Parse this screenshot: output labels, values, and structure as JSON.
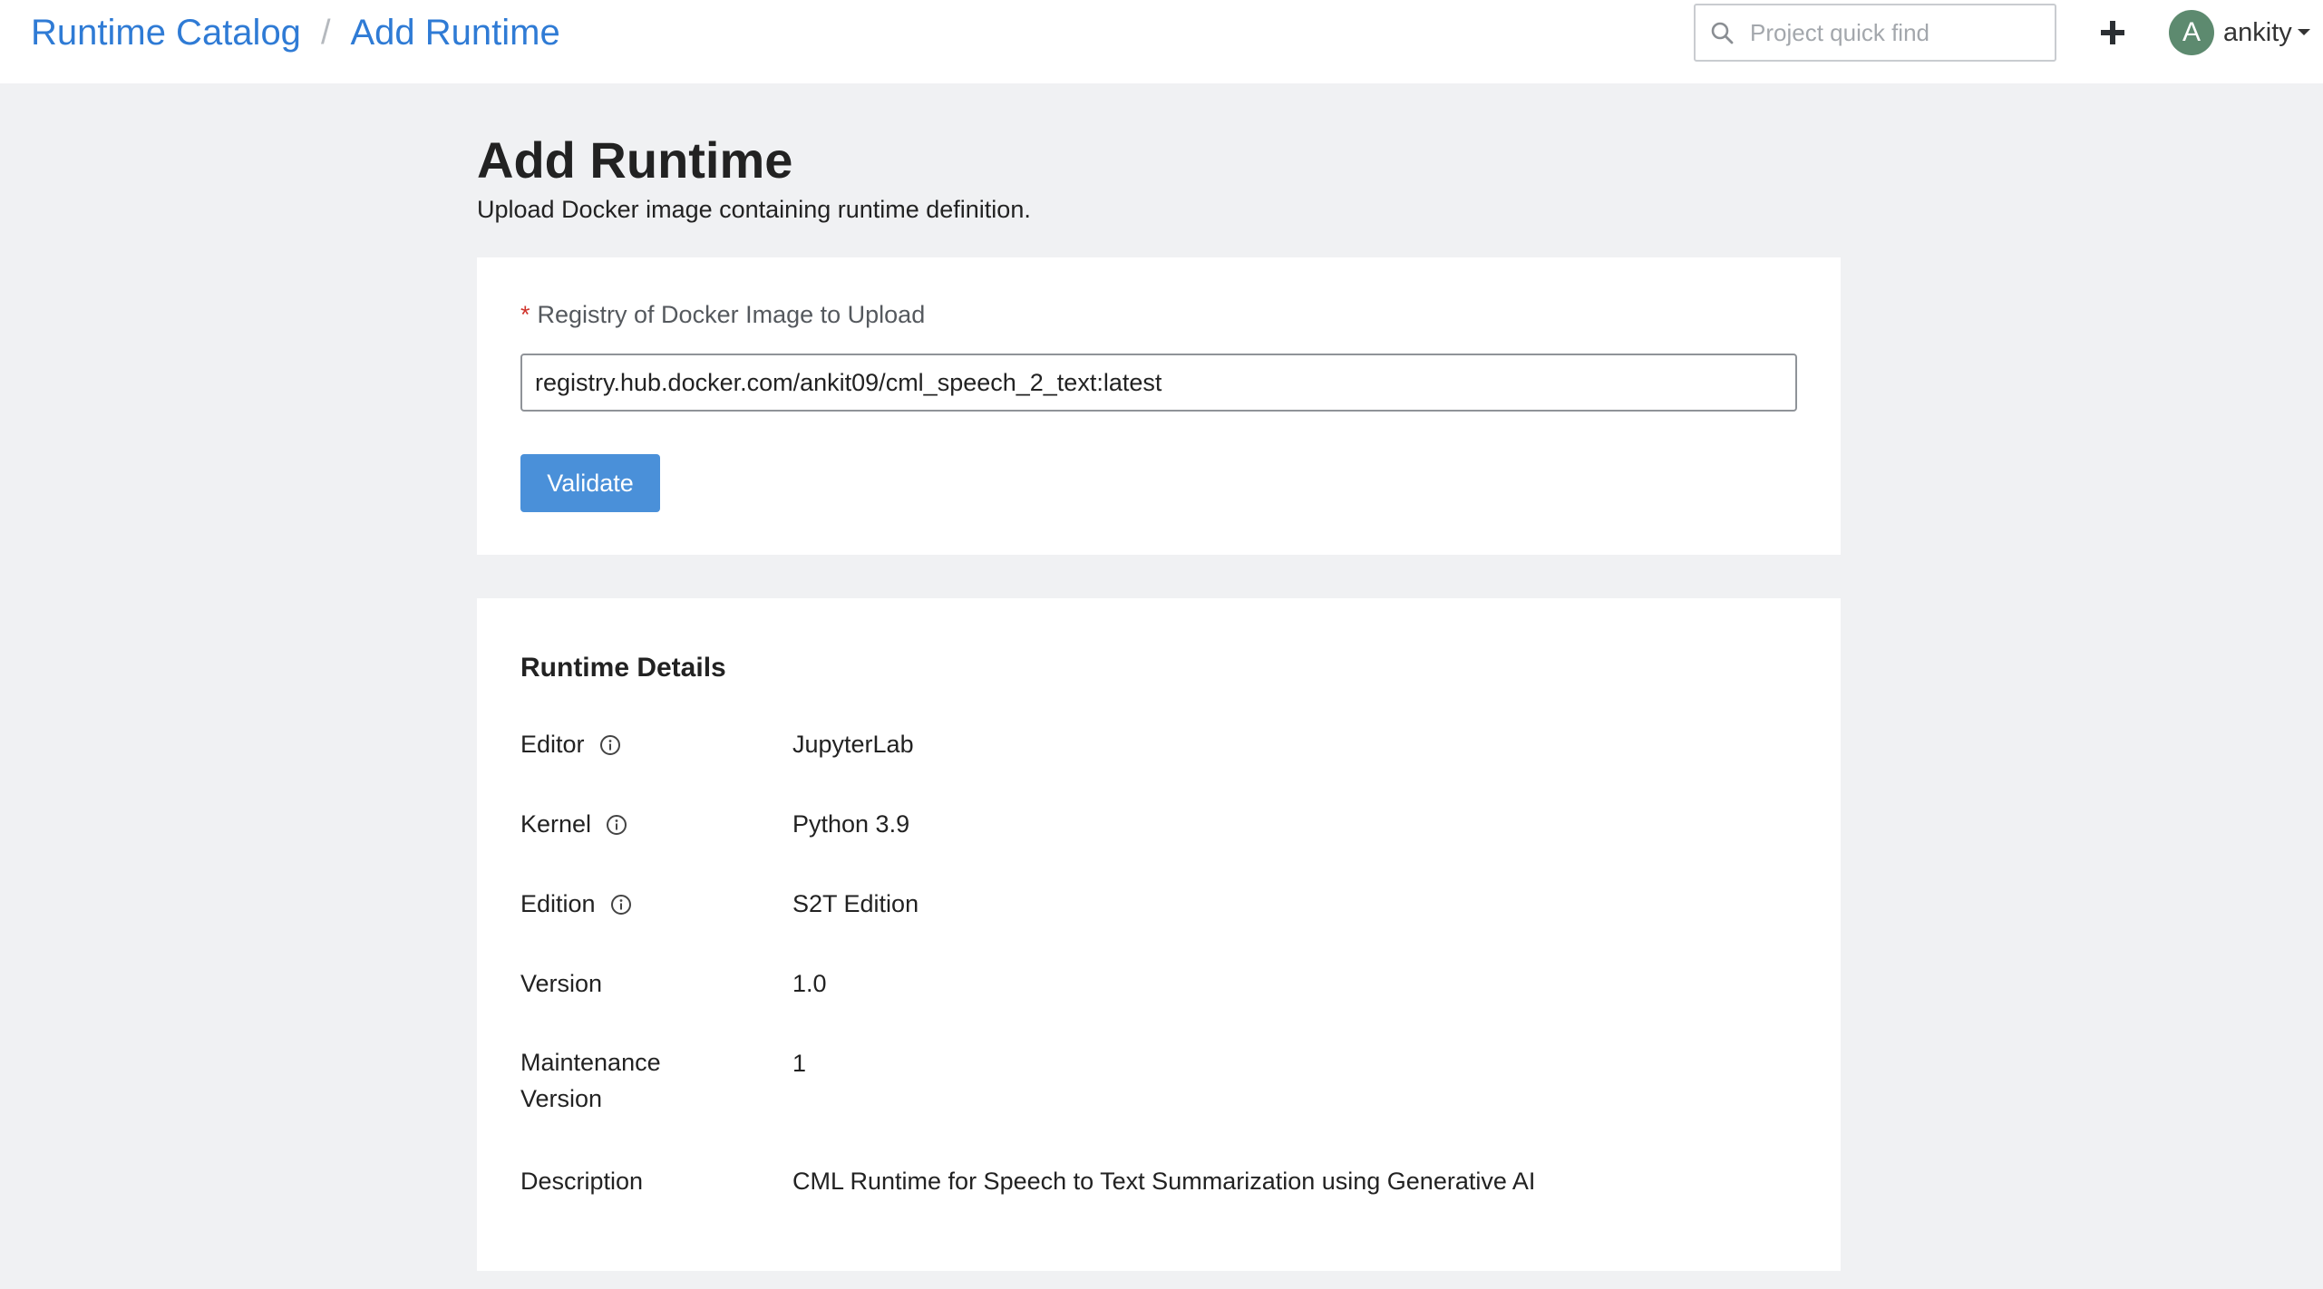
{
  "breadcrumb": {
    "parent": "Runtime Catalog",
    "separator": "/",
    "current": "Add Runtime"
  },
  "header": {
    "search_placeholder": "Project quick find",
    "user": {
      "initial": "A",
      "name": "ankity"
    },
    "avatar_color": "#5d8a6f"
  },
  "page": {
    "title": "Add Runtime",
    "subtitle": "Upload Docker image containing runtime definition."
  },
  "upload_form": {
    "required_marker": "*",
    "label": "Registry of Docker Image to Upload",
    "value": "registry.hub.docker.com/ankit09/cml_speech_2_text:latest",
    "validate_label": "Validate"
  },
  "details": {
    "title": "Runtime Details",
    "rows": [
      {
        "label": "Editor",
        "value": "JupyterLab",
        "info": true
      },
      {
        "label": "Kernel",
        "value": "Python 3.9",
        "info": true
      },
      {
        "label": "Edition",
        "value": "S2T Edition",
        "info": true
      },
      {
        "label": "Version",
        "value": "1.0",
        "info": false
      },
      {
        "label": "Maintenance Version",
        "value": "1",
        "info": false
      },
      {
        "label": "Description",
        "value": "CML Runtime for Speech to Text Summarization using Generative AI",
        "info": false
      }
    ]
  },
  "colors": {
    "link": "#2f7bd5",
    "primary_button": "#4a90d9",
    "required": "#d0342c",
    "page_background": "#f0f1f3"
  },
  "icons": [
    "search-icon",
    "plus-icon",
    "caret-down-icon",
    "info-icon"
  ]
}
